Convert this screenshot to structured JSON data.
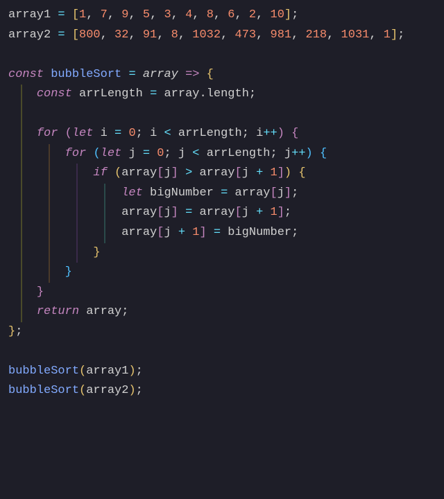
{
  "code": {
    "l1": {
      "a": "array1 ",
      "b": "= ",
      "c": "[",
      "nums": [
        "1",
        "7",
        "9",
        "5",
        "3",
        "4",
        "8",
        "6",
        "2",
        "10"
      ],
      "d": "]",
      "e": ";"
    },
    "l2": {
      "a": "array2 ",
      "b": "= ",
      "c": "[",
      "nums": [
        "800",
        "32",
        "91",
        "8",
        "1032",
        "473",
        "981",
        "218",
        "1031",
        "1"
      ],
      "d": "]",
      "e": ";"
    },
    "blank": "",
    "l4": {
      "const": "const ",
      "fn": "bubbleSort ",
      "eq": "= ",
      "param": "array ",
      "arrow": "=> ",
      "brace": "{"
    },
    "l5": {
      "const": "const ",
      "var": "arrLength ",
      "eq": "= ",
      "arr": "array",
      "dot": ".",
      "prop": "length",
      "semi": ";"
    },
    "l7": {
      "for": "for ",
      "lp": "(",
      "let": "let ",
      "v": "i ",
      "eq": "= ",
      "n": "0",
      "semi": "; ",
      "v2": "i ",
      "lt": "< ",
      "arr": "arrLength",
      "semi2": "; ",
      "v3": "i",
      "inc": "++",
      "rp": ") ",
      "brace": "{"
    },
    "l8": {
      "for": "for ",
      "lp": "(",
      "let": "let ",
      "v": "j ",
      "eq": "= ",
      "n": "0",
      "semi": "; ",
      "v2": "j ",
      "lt": "< ",
      "arr": "arrLength",
      "semi2": "; ",
      "v3": "j",
      "inc": "++",
      "rp": ") ",
      "brace": "{"
    },
    "l9": {
      "if": "if ",
      "lp": "(",
      "arr": "array",
      "lb": "[",
      "j": "j",
      "rb": "] ",
      "gt": "> ",
      "arr2": "array",
      "lb2": "[",
      "j2": "j ",
      "plus": "+ ",
      "one": "1",
      "rb2": "]",
      "rp": ") ",
      "brace": "{"
    },
    "l10": {
      "let": "let ",
      "v": "bigNumber ",
      "eq": "= ",
      "arr": "array",
      "lb": "[",
      "j": "j",
      "rb": "]",
      "semi": ";"
    },
    "l11": {
      "arr": "array",
      "lb": "[",
      "j": "j",
      "rb": "] ",
      "eq": "= ",
      "arr2": "array",
      "lb2": "[",
      "j2": "j ",
      "plus": "+ ",
      "one": "1",
      "rb2": "]",
      "semi": ";"
    },
    "l12": {
      "arr": "array",
      "lb": "[",
      "j": "j ",
      "plus": "+ ",
      "one": "1",
      "rb": "] ",
      "eq": "= ",
      "v": "bigNumber",
      "semi": ";"
    },
    "l13": {
      "brace": "}"
    },
    "l14": {
      "brace": "}"
    },
    "l15": {
      "brace": "}"
    },
    "l16": {
      "ret": "return ",
      "v": "array",
      "semi": ";"
    },
    "l17": {
      "brace": "}",
      "semi": ";"
    },
    "l19": {
      "fn": "bubbleSort",
      "lp": "(",
      "v": "array1",
      "rp": ")",
      "semi": ";"
    },
    "l20": {
      "fn": "bubbleSort",
      "lp": "(",
      "v": "array2",
      "rp": ")",
      "semi": ";"
    }
  }
}
